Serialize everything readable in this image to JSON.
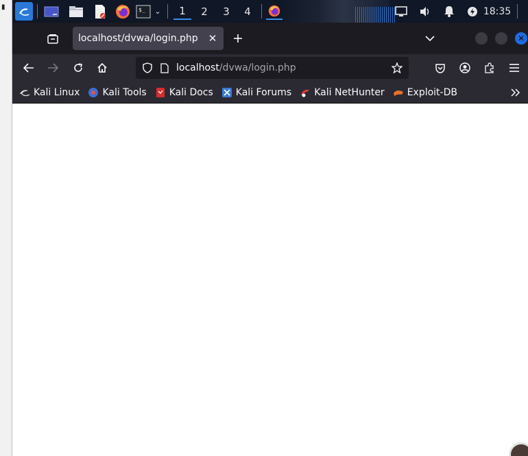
{
  "taskbar": {
    "icons": [
      "kali-menu-icon",
      "desktop-icon",
      "file-manager-icon",
      "text-editor-icon",
      "firefox-icon",
      "terminal-icon"
    ],
    "workspaces": [
      "1",
      "2",
      "3",
      "4"
    ],
    "active_workspace": "1",
    "clock": "18:35",
    "colors": {
      "background": "#101726",
      "accent": "#2a79d8"
    }
  },
  "browser": {
    "tab": {
      "title": "localhost/dvwa/login.php"
    },
    "url": {
      "host": "localhost",
      "path": "/dvwa/login.php"
    },
    "bookmarks": [
      {
        "label": "Kali Linux",
        "icon": "kali-dragon-icon"
      },
      {
        "label": "Kali Tools",
        "icon": "kali-tools-icon"
      },
      {
        "label": "Kali Docs",
        "icon": "kali-docs-icon"
      },
      {
        "label": "Kali Forums",
        "icon": "kali-forums-icon"
      },
      {
        "label": "Kali NetHunter",
        "icon": "nethunter-icon"
      },
      {
        "label": "Exploit-DB",
        "icon": "exploit-db-icon"
      }
    ],
    "colors": {
      "tabbar": "#1c1b22",
      "toolbar": "#2b2a33",
      "tab_active": "#42414d",
      "close_button": "#1f6ce0"
    }
  }
}
